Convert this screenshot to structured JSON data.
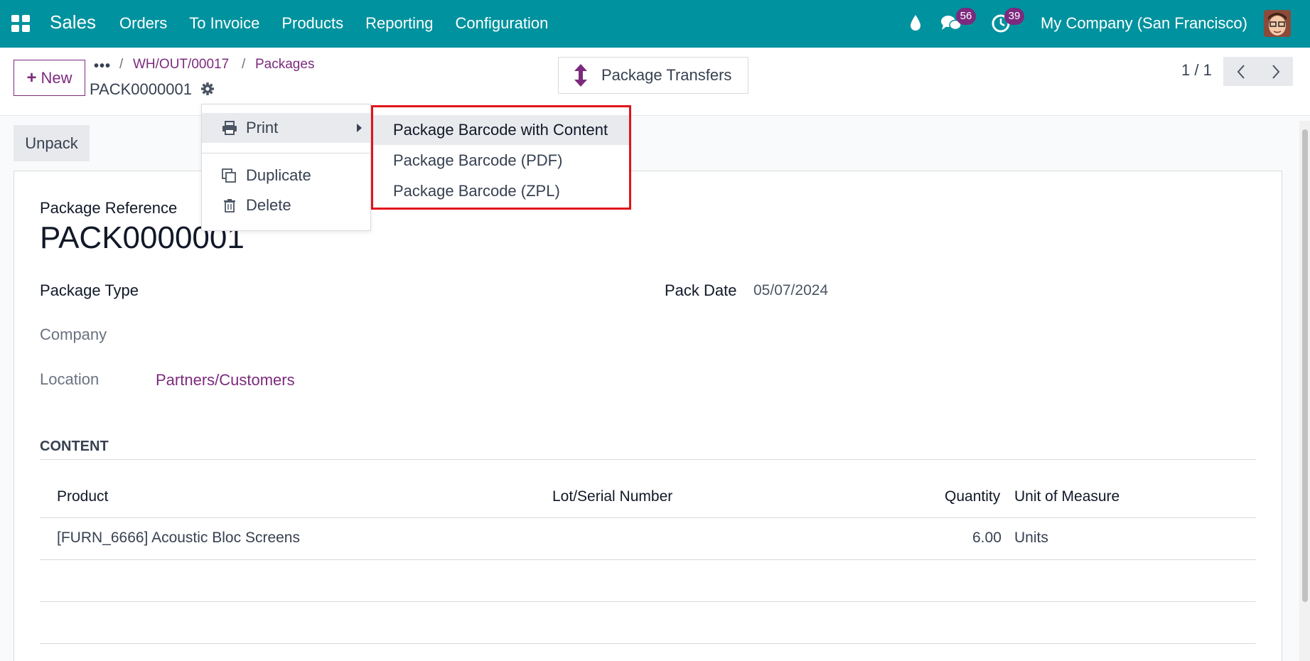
{
  "navbar": {
    "app_name": "Sales",
    "menu": [
      "Orders",
      "To Invoice",
      "Products",
      "Reporting",
      "Configuration"
    ],
    "chat_count": "56",
    "activity_count": "39",
    "company": "My Company (San Francisco)",
    "accent_color": "#00929e"
  },
  "control_panel": {
    "new_label": "New",
    "breadcrumb": [
      "WH/OUT/00017",
      "Packages"
    ],
    "record_name": "PACK0000001",
    "smart_button_label": "Package Transfers",
    "pager": "1 / 1"
  },
  "dropdown": {
    "print_label": "Print",
    "duplicate_label": "Duplicate",
    "delete_label": "Delete",
    "print_submenu": [
      "Package Barcode with Content",
      "Package Barcode (PDF)",
      "Package Barcode (ZPL)"
    ]
  },
  "status_bar": {
    "unpack_label": "Unpack"
  },
  "form": {
    "package_reference_label": "Package Reference",
    "package_reference": "PACK0000001",
    "package_type_label": "Package Type",
    "pack_date_label": "Pack Date",
    "pack_date": "05/07/2024",
    "company_label": "Company",
    "location_label": "Location",
    "location": "Partners/Customers",
    "content_title": "CONTENT",
    "table": {
      "headers": [
        "Product",
        "Lot/Serial Number",
        "Quantity",
        "Unit of Measure"
      ],
      "rows": [
        {
          "product": "[FURN_6666] Acoustic Bloc Screens",
          "lot": "",
          "quantity": "6.00",
          "uom": "Units"
        }
      ]
    }
  }
}
